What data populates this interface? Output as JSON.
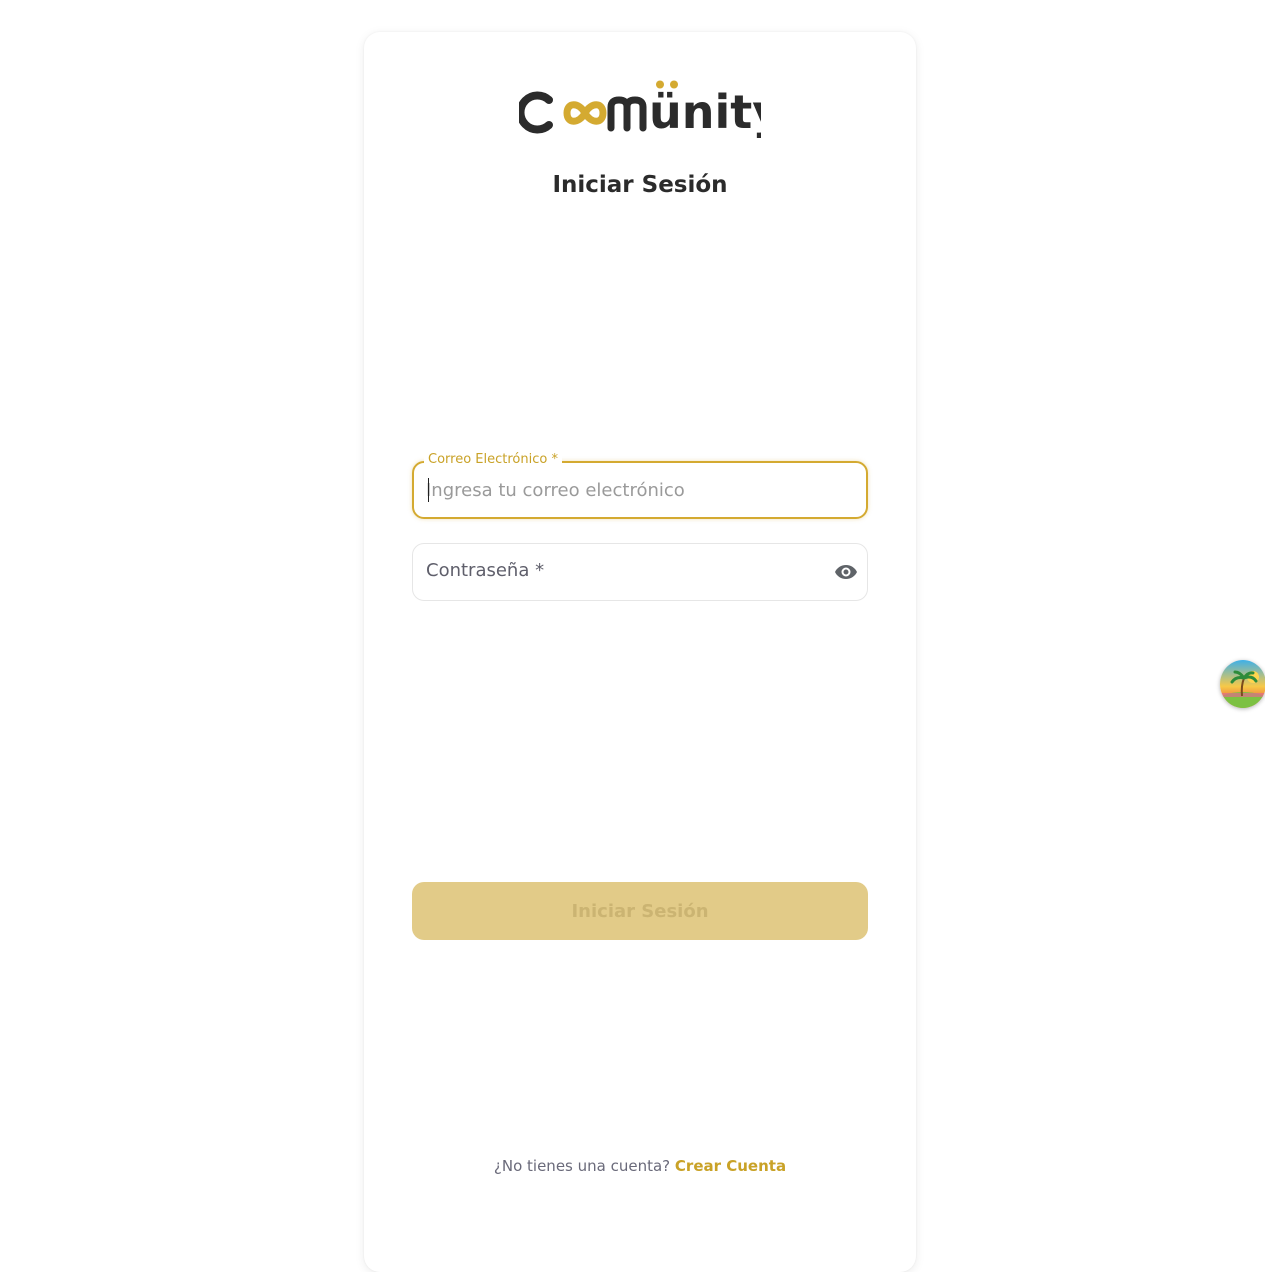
{
  "brand": {
    "name": "Coomünity",
    "accent_color": "#d4aa31",
    "dark_color": "#2b2b2b"
  },
  "login": {
    "title": "Iniciar Sesión",
    "email": {
      "label": "Correo Electrónico *",
      "placeholder": "Ingresa tu correo electrónico",
      "value": ""
    },
    "password": {
      "label": "Contraseña *",
      "toggle_icon": "eye-icon"
    },
    "submit_label": "Iniciar Sesión",
    "footer": {
      "question": "¿No tienes una cuenta?",
      "link": "Crear Cuenta"
    }
  },
  "widget": {
    "icon": "palm-island-icon"
  }
}
